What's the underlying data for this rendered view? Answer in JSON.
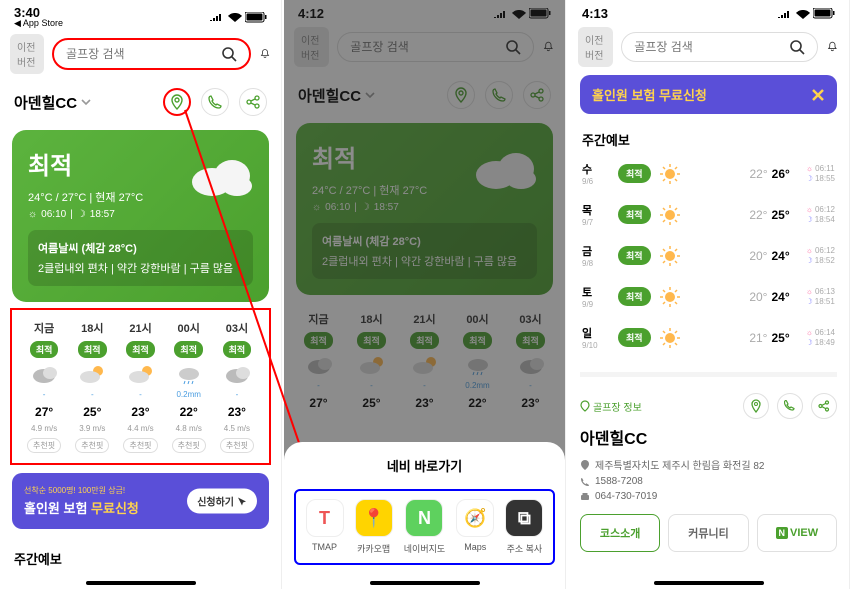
{
  "status": {
    "time1": "3:40",
    "time2": "4:12",
    "time3": "4:13",
    "back_label": "◀ App Store"
  },
  "header": {
    "prev_version": "이전버전",
    "search_placeholder": "골프장 검색"
  },
  "course": {
    "name": "아덴힐CC"
  },
  "weather": {
    "condition": "최적",
    "temp_line": "24°C / 27°C | 현재 27°C",
    "sunrise": "06:10",
    "sunset": "18:57",
    "detail_title": "여름날씨 (체감 28°C)",
    "detail_body": "2클럽내외 편차 | 약간 강한바람 | 구름 많음"
  },
  "hourly": [
    {
      "time": "지금",
      "badge": "최적",
      "rain": "-",
      "temp": "27°",
      "wind": "4.9 m/s",
      "rec": "추천핏"
    },
    {
      "time": "18시",
      "badge": "최적",
      "rain": "-",
      "temp": "25°",
      "wind": "3.9 m/s",
      "rec": "추천핏"
    },
    {
      "time": "21시",
      "badge": "최적",
      "rain": "-",
      "temp": "23°",
      "wind": "4.4 m/s",
      "rec": "추천핏"
    },
    {
      "time": "00시",
      "badge": "최적",
      "rain": "0.2mm",
      "temp": "22°",
      "wind": "4.8 m/s",
      "rec": "추천핏"
    },
    {
      "time": "03시",
      "badge": "최적",
      "rain": "-",
      "temp": "23°",
      "wind": "4.5 m/s",
      "rec": "추천핏"
    }
  ],
  "promo": {
    "small": "선착순 5000명! 100만원 상금!",
    "title_a": "홀인원 보험 ",
    "title_b": "무료신청",
    "button": "신청하기"
  },
  "weekly_title": "주간예보",
  "nav_sheet": {
    "title": "네비 바로가기",
    "apps": [
      {
        "label": "TMAP"
      },
      {
        "label": "카카오맵"
      },
      {
        "label": "네이버지도"
      },
      {
        "label": "Maps"
      },
      {
        "label": "주소 복사"
      }
    ]
  },
  "weekly": [
    {
      "dow": "수",
      "date": "9/6",
      "badge": "최적",
      "lo": "22°",
      "hi": "26°",
      "rise": "06:11",
      "set": "18:55"
    },
    {
      "dow": "목",
      "date": "9/7",
      "badge": "최적",
      "lo": "22°",
      "hi": "25°",
      "rise": "06:12",
      "set": "18:54"
    },
    {
      "dow": "금",
      "date": "9/8",
      "badge": "최적",
      "lo": "20°",
      "hi": "24°",
      "rise": "06:12",
      "set": "18:52"
    },
    {
      "dow": "토",
      "date": "9/9",
      "badge": "최적",
      "lo": "20°",
      "hi": "24°",
      "rise": "06:13",
      "set": "18:51"
    },
    {
      "dow": "일",
      "date": "9/10",
      "badge": "최적",
      "lo": "21°",
      "hi": "25°",
      "rise": "06:14",
      "set": "18:49"
    }
  ],
  "info": {
    "label": "골프장 정보",
    "name": "아덴힐CC",
    "address": "제주특별자치도 제주시 한림읍 화전길 82",
    "phone1": "1588-7208",
    "phone2": "064-730-7019",
    "tabs": [
      "코스소개",
      "커뮤니티",
      "VIEW"
    ]
  },
  "purple_top": "홀인원 보험 무료신청"
}
